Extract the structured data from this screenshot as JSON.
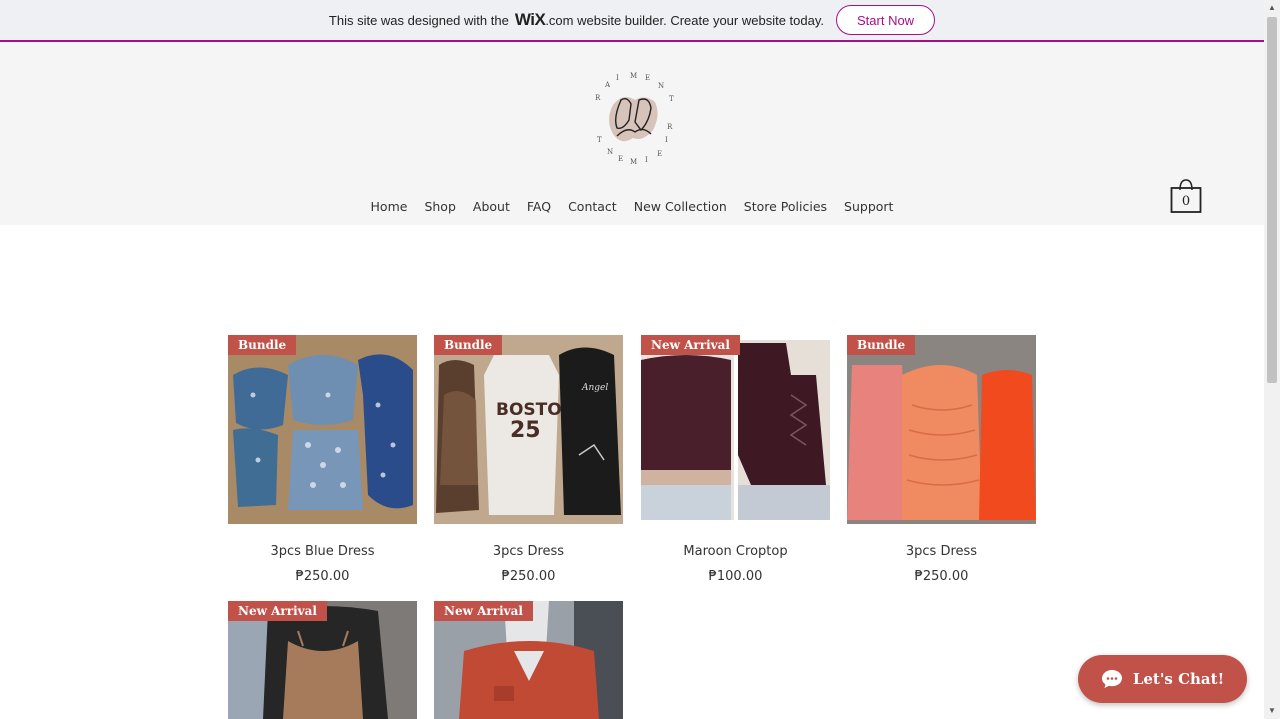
{
  "banner": {
    "text_before": "This site was designed with the",
    "wix": "WiX",
    "text_after": ".com website builder. Create your website today.",
    "cta": "Start Now"
  },
  "nav": {
    "items": [
      "Home",
      "Shop",
      "About",
      "FAQ",
      "Contact",
      "New Collection",
      "Store Policies",
      "Support"
    ]
  },
  "cart": {
    "count": "0"
  },
  "products": [
    {
      "ribbon": "Bundle",
      "name": "3pcs Blue Dress",
      "price": "₱250.00"
    },
    {
      "ribbon": "Bundle",
      "name": "3pcs Dress",
      "price": "₱250.00"
    },
    {
      "ribbon": "New Arrival",
      "name": "Maroon Croptop",
      "price": "₱100.00"
    },
    {
      "ribbon": "Bundle",
      "name": "3pcs Dress",
      "price": "₱250.00"
    },
    {
      "ribbon": "New Arrival",
      "name": "",
      "price": ""
    },
    {
      "ribbon": "New Arrival",
      "name": "",
      "price": ""
    }
  ],
  "chat": {
    "label": "Let's Chat!"
  },
  "colors": {
    "accent": "#a40f8c",
    "ribbon": "#c0524a",
    "header_bg": "#f5f5f5"
  }
}
